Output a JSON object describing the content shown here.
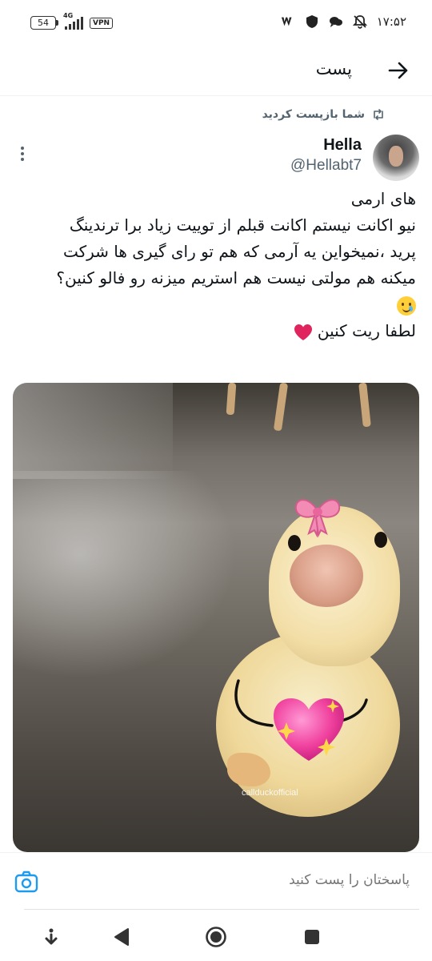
{
  "status_bar": {
    "battery_level": "54",
    "network_type": "4G",
    "vpn_label": "VPN",
    "time": "۱۷:۵۲"
  },
  "header": {
    "title": "پست",
    "back_icon": "arrow-right-icon"
  },
  "tweet": {
    "retweet_label": "شما بازپست کردید",
    "author_name": "Hella",
    "author_handle": "@Hellabt7",
    "text_lines": [
      "های ارمی",
      "نیو اکانت نیستم اکانت قبلم از توییت زیاد برا ترندینگ",
      "پرید ،نمیخواین یه آرمی که هم تو رای گیری ها شرکت",
      "میکنه هم مولتی نیست هم استریم میزنه رو فالو کنین؟",
      "",
      "لطفا ریت کنین"
    ],
    "emoji_tear": "smiling-face-with-tear-emoji",
    "emoji_heart": "red-heart-emoji",
    "media_watermark": "callduckofficial"
  },
  "reply": {
    "placeholder": "پاسختان را پست کنید",
    "camera_icon": "camera-icon"
  },
  "nav": {
    "icons": [
      "download-icon",
      "back-triangle-icon",
      "home-circle-icon",
      "recents-square-icon"
    ]
  },
  "colors": {
    "accent": "#1d9bf0",
    "text_primary": "#0f1419",
    "text_secondary": "#536471",
    "heart_red": "#e0245e"
  }
}
